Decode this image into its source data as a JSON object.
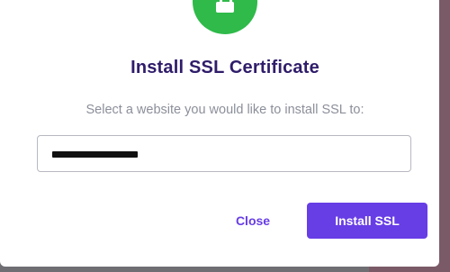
{
  "dialog": {
    "title": "Install SSL Certificate",
    "subtitle": "Select a website you would like to install SSL to:",
    "website_select": {
      "value": ""
    },
    "actions": {
      "close_label": "Close",
      "install_label": "Install SSL"
    }
  },
  "colors": {
    "accent": "#673de6",
    "success": "#2fba4a",
    "title": "#2f1c6a",
    "muted": "#8c8f9a"
  },
  "icons": {
    "header": "lock-icon"
  }
}
